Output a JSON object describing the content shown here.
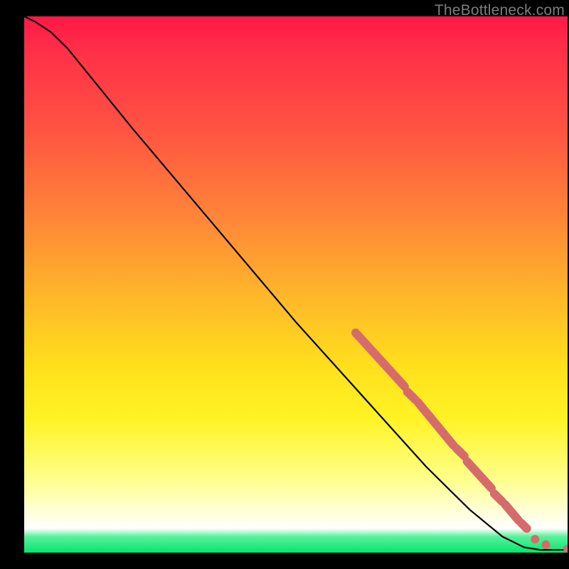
{
  "watermark": "TheBottleneck.com",
  "chart_data": {
    "type": "line",
    "title": "",
    "xlabel": "",
    "ylabel": "",
    "xlim": [
      0,
      100
    ],
    "ylim": [
      0,
      100
    ],
    "grid": false,
    "legend": false,
    "series": [
      {
        "name": "curve",
        "color": "#000000",
        "points": [
          {
            "x": 0,
            "y": 100
          },
          {
            "x": 2,
            "y": 99
          },
          {
            "x": 5,
            "y": 97
          },
          {
            "x": 8,
            "y": 94
          },
          {
            "x": 12,
            "y": 89
          },
          {
            "x": 20,
            "y": 79
          },
          {
            "x": 30,
            "y": 67
          },
          {
            "x": 40,
            "y": 55
          },
          {
            "x": 50,
            "y": 43
          },
          {
            "x": 58,
            "y": 34
          },
          {
            "x": 66,
            "y": 25
          },
          {
            "x": 74,
            "y": 16
          },
          {
            "x": 82,
            "y": 8
          },
          {
            "x": 88,
            "y": 3
          },
          {
            "x": 92,
            "y": 1
          },
          {
            "x": 95,
            "y": 0.5
          },
          {
            "x": 100,
            "y": 0.5
          }
        ]
      }
    ],
    "markers": {
      "name": "highlight-segments",
      "color": "#d66b6b",
      "segments": [
        {
          "x0": 61,
          "y0": 41,
          "x1": 70,
          "y1": 31
        },
        {
          "x0": 70.5,
          "y0": 30,
          "x1": 72,
          "y1": 28.5
        },
        {
          "x0": 72.5,
          "y0": 28,
          "x1": 79,
          "y1": 20
        },
        {
          "x0": 79.5,
          "y0": 19.5,
          "x1": 81,
          "y1": 18
        },
        {
          "x0": 81.5,
          "y0": 17,
          "x1": 86,
          "y1": 12
        },
        {
          "x0": 86.5,
          "y0": 11,
          "x1": 88,
          "y1": 9.5
        },
        {
          "x0": 88.5,
          "y0": 9,
          "x1": 91,
          "y1": 6
        },
        {
          "x0": 91.5,
          "y0": 5.5,
          "x1": 92.5,
          "y1": 4.5
        }
      ],
      "dots": [
        {
          "x": 94,
          "y": 2.5
        },
        {
          "x": 96,
          "y": 1.5
        },
        {
          "x": 100,
          "y": 0.7
        }
      ]
    }
  }
}
